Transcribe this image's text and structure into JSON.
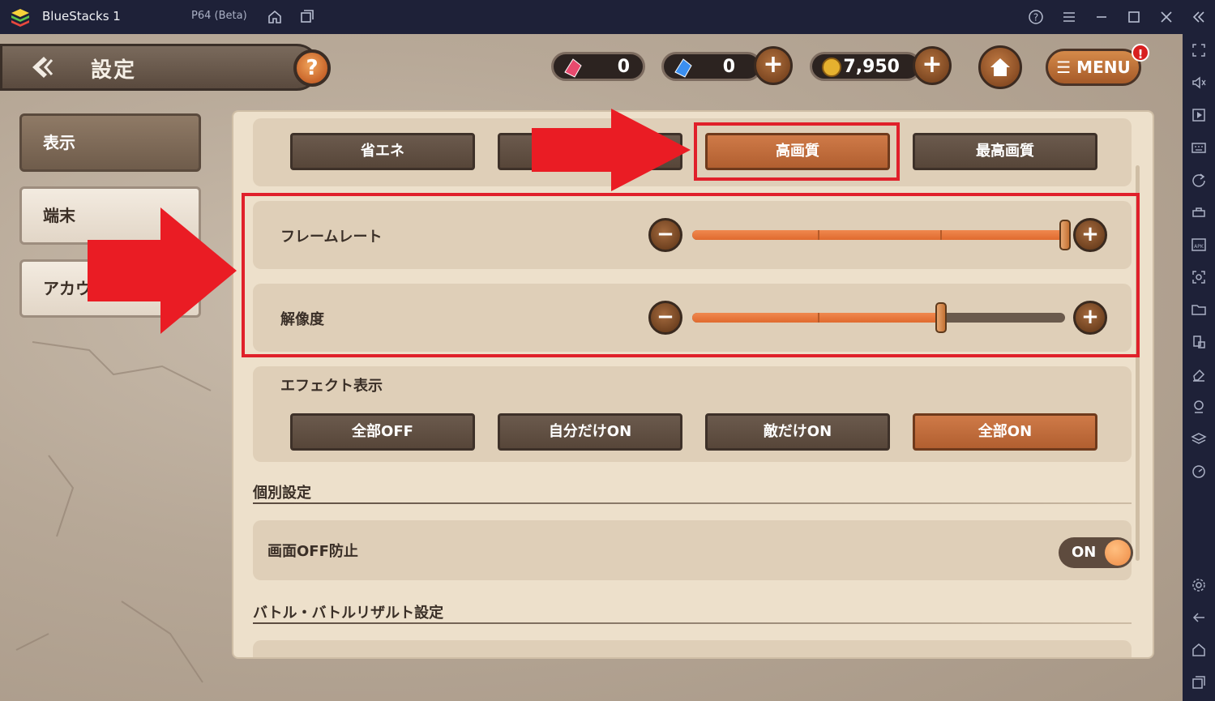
{
  "window": {
    "app_title": "BlueStacks 1",
    "version": "P64 (Beta)",
    "icons": [
      "home-icon",
      "multi-instance-icon",
      "help-icon",
      "hamburger-icon",
      "minimize-icon",
      "maximize-icon",
      "close-icon",
      "collapse-sidebar-icon"
    ]
  },
  "sidebar": {
    "icons": [
      "fullscreen-icon",
      "volume-icon",
      "media-icon",
      "keyboard-icon",
      "rotate-icon",
      "gamepad-icon",
      "apk-icon",
      "screenshot-icon",
      "folder-icon",
      "multi-window-icon",
      "eraser-icon",
      "location-icon",
      "layers-icon",
      "performance-icon",
      "settings-icon",
      "back-icon",
      "home-icon",
      "recent-apps-icon"
    ]
  },
  "header": {
    "title": "設定",
    "help_label": "?",
    "currency": [
      {
        "name": "red-gem",
        "value": "0"
      },
      {
        "name": "blue-gem",
        "value": "0"
      },
      {
        "name": "gold-coin",
        "value": "7,950"
      }
    ],
    "plus_label": "+",
    "menu_label": "☰ MENU",
    "menu_badge": "!"
  },
  "categories": [
    {
      "label": "表示",
      "active": true
    },
    {
      "label": "端末",
      "active": false
    },
    {
      "label": "アカウ",
      "active": false
    }
  ],
  "quality": {
    "options": [
      {
        "label": "省エネ",
        "selected": false
      },
      {
        "label": "",
        "selected": false
      },
      {
        "label": "高画質",
        "selected": true
      },
      {
        "label": "最高画質",
        "selected": false
      }
    ]
  },
  "sliders": {
    "framerate": {
      "label": "フレームレート",
      "level": 1.0
    },
    "resolution": {
      "label": "解像度",
      "level": 0.6667
    }
  },
  "effects": {
    "label": "エフェクト表示",
    "options": [
      {
        "label": "全部OFF",
        "selected": false
      },
      {
        "label": "自分だけON",
        "selected": false
      },
      {
        "label": "敵だけON",
        "selected": false
      },
      {
        "label": "全部ON",
        "selected": true
      }
    ]
  },
  "individual": {
    "heading": "個別設定",
    "screen_off": {
      "label": "画面OFF防止",
      "toggle": "ON"
    }
  },
  "battle": {
    "heading": "バトル・バトルリザルト設定"
  },
  "colors": {
    "accent": "#c4683a",
    "highlight": "#e0202a"
  }
}
